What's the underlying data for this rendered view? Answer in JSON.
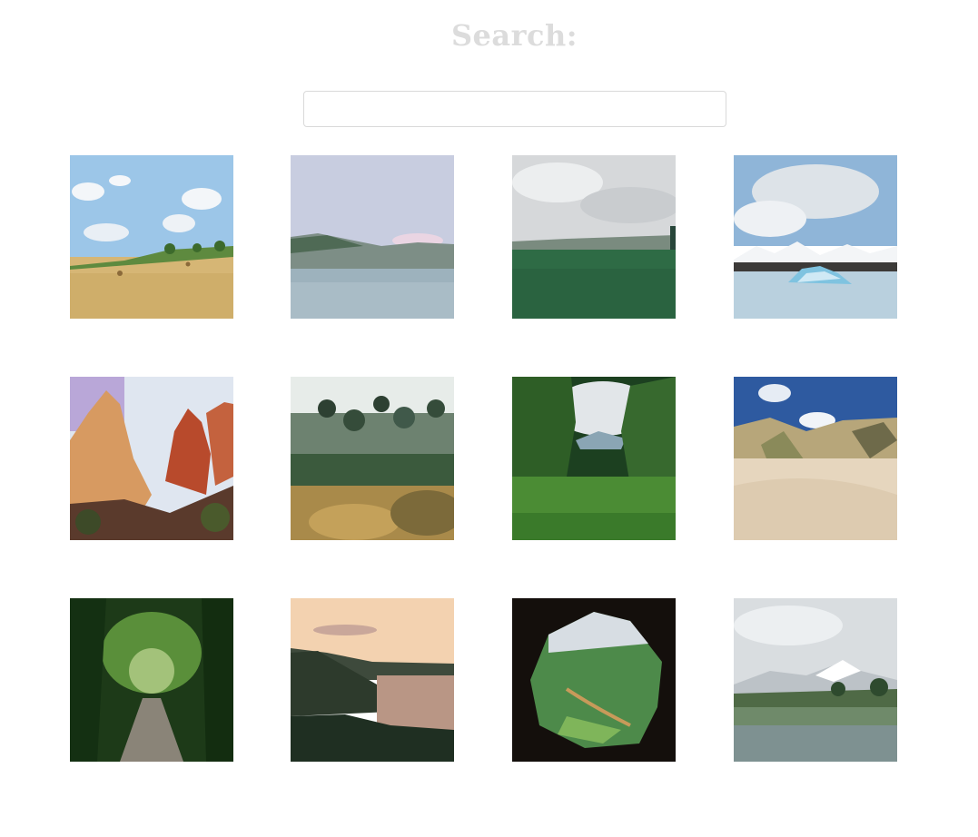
{
  "header": {
    "title": "Search:"
  },
  "search": {
    "value": "",
    "placeholder": ""
  },
  "gallery": {
    "images": [
      {
        "icon": "field-hay-bales-image"
      },
      {
        "icon": "lake-mountains-image"
      },
      {
        "icon": "green-meadow-cloudy-image"
      },
      {
        "icon": "glacier-lagoon-icebergs-image"
      },
      {
        "icon": "red-rock-canyon-image"
      },
      {
        "icon": "garden-trees-image"
      },
      {
        "icon": "jungle-valley-image"
      },
      {
        "icon": "sand-dunes-beach-image"
      },
      {
        "icon": "forest-path-image"
      },
      {
        "icon": "coastal-sunset-image"
      },
      {
        "icon": "cave-view-valley-image"
      },
      {
        "icon": "snowy-mountain-meadow-image"
      }
    ]
  }
}
